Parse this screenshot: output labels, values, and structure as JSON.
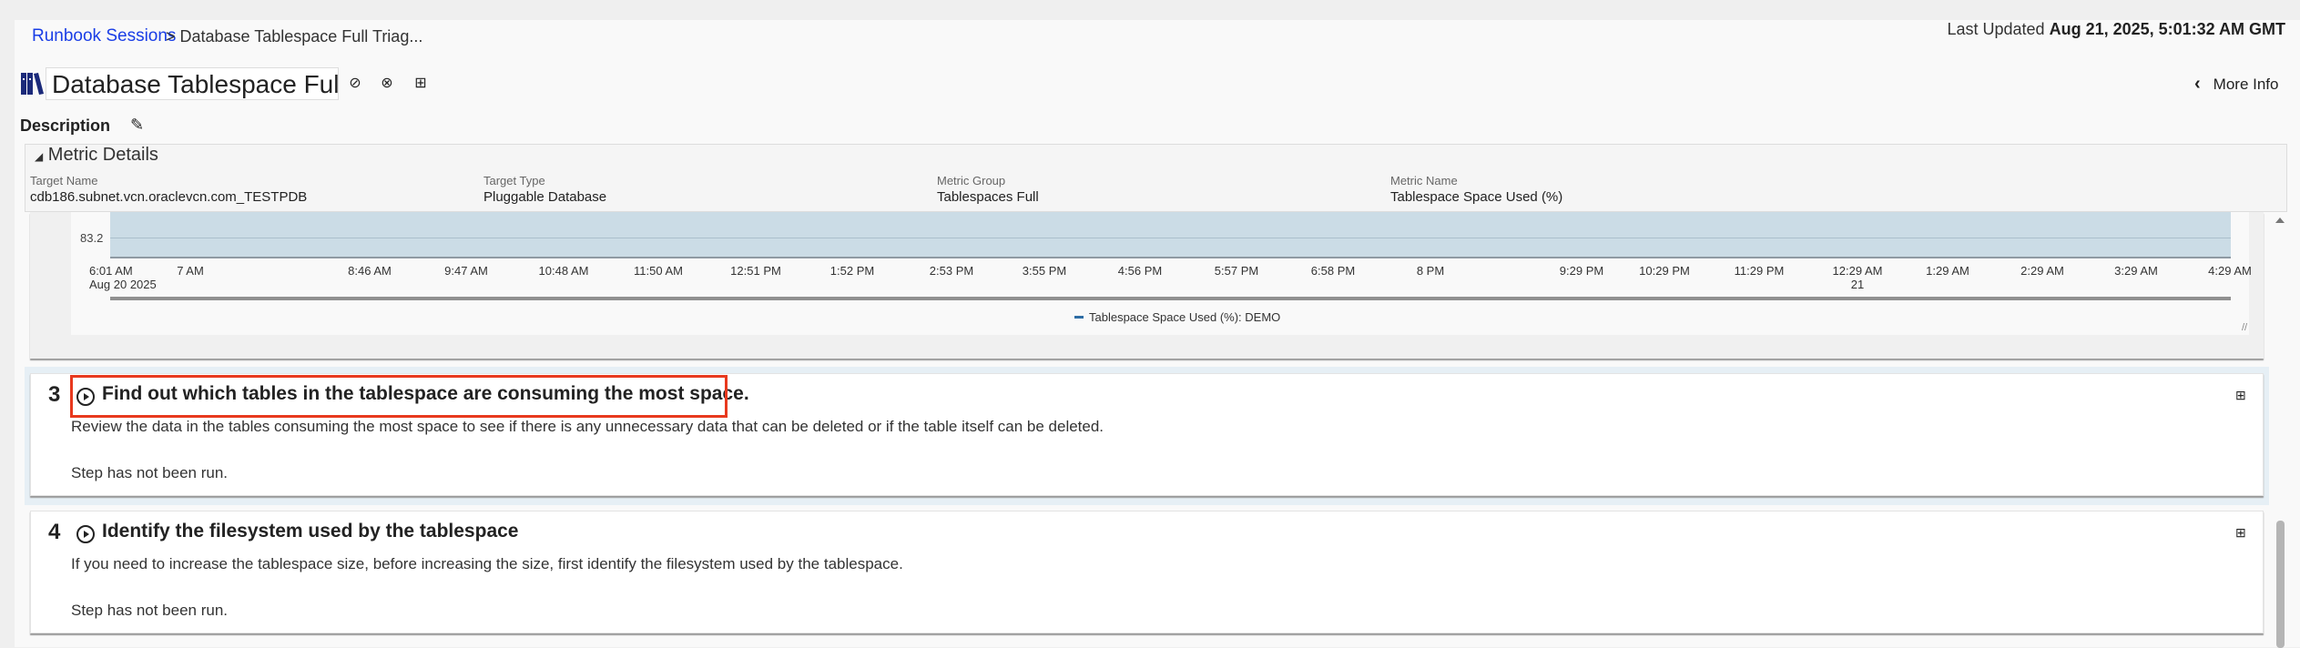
{
  "breadcrumb": {
    "root": "Runbook Sessions",
    "current": "> Database Tablespace Full Triag..."
  },
  "last_updated": {
    "label": "Last Updated",
    "value": "Aug 21, 2025, 5:01:32 AM GMT"
  },
  "title": "Database Tablespace Full Tri",
  "more_info": "More Info",
  "description_label": "Description",
  "metric_details": {
    "heading": "Metric Details",
    "fields": [
      {
        "label": "Target Name",
        "value": "cdb186.subnet.vcn.oraclevcn.com_TESTPDB"
      },
      {
        "label": "Target Type",
        "value": "Pluggable Database"
      },
      {
        "label": "Metric Group",
        "value": "Tablespaces Full"
      },
      {
        "label": "Metric Name",
        "value": "Tablespace Space Used (%)"
      }
    ]
  },
  "chart_data": {
    "type": "area",
    "y_tick_labels": [
      "83.2"
    ],
    "x_tick_labels": [
      "6:01 AM\nAug 20 2025",
      "7 AM",
      "8:46 AM",
      "9:47 AM",
      "10:48 AM",
      "11:50 AM",
      "12:51 PM",
      "1:52 PM",
      "2:53 PM",
      "3:55 PM",
      "4:56 PM",
      "5:57 PM",
      "6:58 PM",
      "8 PM",
      "9:29 PM",
      "10:29 PM",
      "11:29 PM",
      "12:29 AM\n21",
      "1:29 AM",
      "2:29 AM",
      "3:29 AM",
      "4:29 AM"
    ],
    "legend": [
      "Tablespace Space Used (%): DEMO"
    ],
    "series_color": "#2e6da4",
    "fill_color": "#cbdce6"
  },
  "steps": [
    {
      "number": "3",
      "title": "Find out which tables in the tablespace are consuming the most space.",
      "description": "Review the data in the tables consuming the most space to see if there is any unnecessary data that can be deleted or if the table itself can be deleted.",
      "status": "Step has not been run."
    },
    {
      "number": "4",
      "title": "Identify the filesystem used by the tablespace",
      "description": "If you need to increase the tablespace size, before increasing the size, first identify the filesystem used by the tablespace.",
      "status": "Step has not been run."
    }
  ]
}
